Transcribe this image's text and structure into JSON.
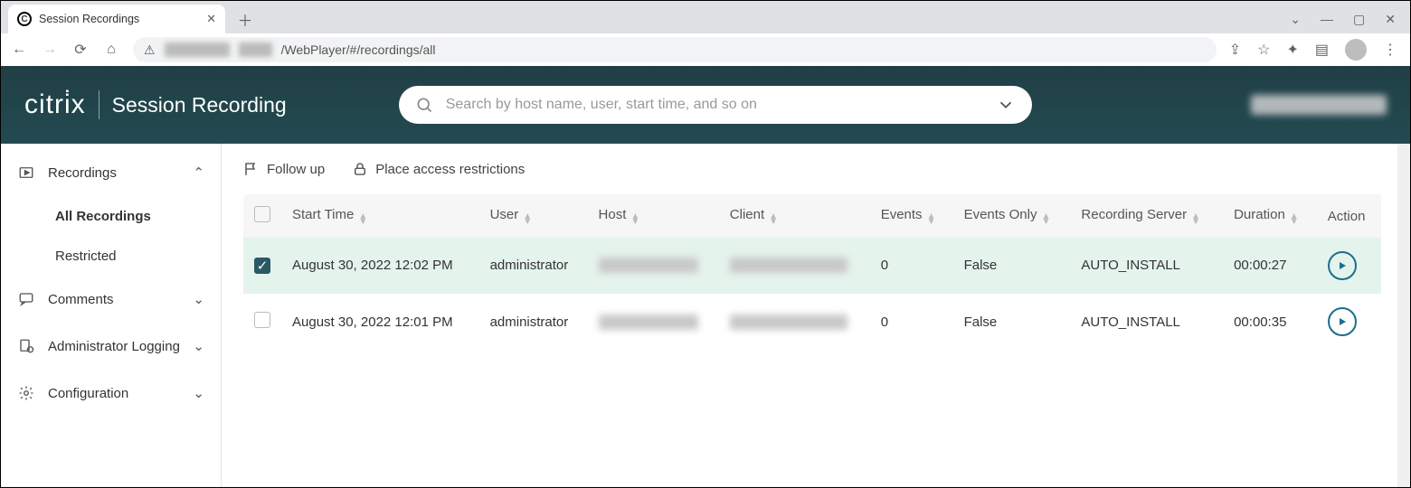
{
  "browser": {
    "tab_title": "Session Recordings",
    "url_visible_suffix": "/WebPlayer/#/recordings/all"
  },
  "header": {
    "brand": "citrix",
    "title": "Session Recording",
    "search_placeholder": "Search by host name, user, start time, and so on"
  },
  "sidebar": {
    "recordings_label": "Recordings",
    "all_recordings_label": "All Recordings",
    "restricted_label": "Restricted",
    "comments_label": "Comments",
    "admin_logging_label": "Administrator Logging",
    "configuration_label": "Configuration"
  },
  "toolbar": {
    "follow_up_label": "Follow up",
    "restrict_label": "Place access restrictions"
  },
  "table": {
    "columns": {
      "start_time": "Start Time",
      "user": "User",
      "host": "Host",
      "client": "Client",
      "events": "Events",
      "events_only": "Events Only",
      "recording_server": "Recording Server",
      "duration": "Duration",
      "action": "Action"
    },
    "rows": [
      {
        "selected": true,
        "start_time": "August 30, 2022 12:02 PM",
        "user": "administrator",
        "events": "0",
        "events_only": "False",
        "recording_server": "AUTO_INSTALL",
        "duration": "00:00:27"
      },
      {
        "selected": false,
        "start_time": "August 30, 2022 12:01 PM",
        "user": "administrator",
        "events": "0",
        "events_only": "False",
        "recording_server": "AUTO_INSTALL",
        "duration": "00:00:35"
      }
    ]
  }
}
